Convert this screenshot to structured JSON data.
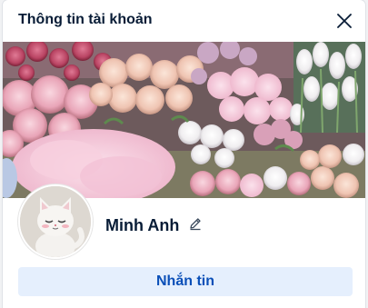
{
  "dialog": {
    "title": "Thông tin tài khoản",
    "close_icon": "close-icon"
  },
  "profile": {
    "cover_image": "pink-flower-bouquets",
    "avatar_image": "white-cartoon-cat",
    "display_name": "Minh Anh",
    "edit_icon": "pencil-icon"
  },
  "actions": {
    "message_label": "Nhắn tin"
  },
  "colors": {
    "title_text": "#081c36",
    "button_bg": "#e5effd",
    "button_text": "#0a4fb8"
  }
}
